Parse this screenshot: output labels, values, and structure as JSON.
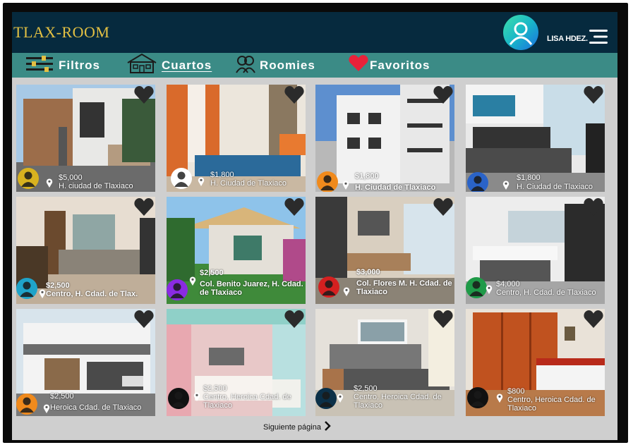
{
  "app": {
    "logo": "TLAX-ROOM",
    "user_name": "LISA HDEZ."
  },
  "nav": {
    "items": [
      {
        "label": "Filtros",
        "icon": "sliders-icon"
      },
      {
        "label": "Cuartos",
        "icon": "house-icon",
        "active": true
      },
      {
        "label": "Roomies",
        "icon": "roomies-icon"
      },
      {
        "label": "Favoritos",
        "icon": "heart-icon"
      }
    ]
  },
  "listings": [
    {
      "price": "$5,000",
      "location": "H. ciudad de Tlaxiaco",
      "avatar_color": "#d8b21f"
    },
    {
      "price": "$1,800",
      "location": "H. Ciudad de Tlaxiaco",
      "avatar_color": "#ffffff"
    },
    {
      "price": "$1,800",
      "location": "H. Ciudad de Tlaxiaco",
      "avatar_color": "#f08a1c"
    },
    {
      "price": "$1,800",
      "location": "H. Ciudad de Tlaxiaco",
      "avatar_color": "#2a63c8"
    },
    {
      "price": "$2,500",
      "location": "Centro, H. Cdad. de Tlax.",
      "avatar_color": "#1fa3c9"
    },
    {
      "price": "$2,500",
      "location": "Col. Benito Juarez, H. Cdad. de Tlaxiaco",
      "avatar_color": "#8a2be2"
    },
    {
      "price": "$3,000",
      "location": "Col. Flores M. H. Cdad. de Tlaxiaco",
      "avatar_color": "#d42020"
    },
    {
      "price": "$4,000",
      "location": "Centro, H. Cdad. de Tlaxiaco",
      "avatar_color": "#1f9a48"
    },
    {
      "price": "$2,500",
      "location": "Heroica Cdad. de Tlaxiaco",
      "avatar_color": "#f08a1c"
    },
    {
      "price": "$2,500",
      "location": "Centro, Heroica Cdad. de Tlaxiaco",
      "avatar_color": "#111111"
    },
    {
      "price": "$2,500",
      "location": "Centro, Heroica Cdad. de Tlaxiaco",
      "avatar_color": "#0b3048"
    },
    {
      "price": "$800",
      "location": "Centro, Heroica Cdad. de Tlaxiaco",
      "avatar_color": "#111111"
    }
  ],
  "pagination": {
    "next_label": "Siguiente página"
  },
  "colors": {
    "header_bg": "#062a3e",
    "nav_bg": "#3b8b86",
    "logo": "#e3c043",
    "favorite": "#e8223a"
  }
}
